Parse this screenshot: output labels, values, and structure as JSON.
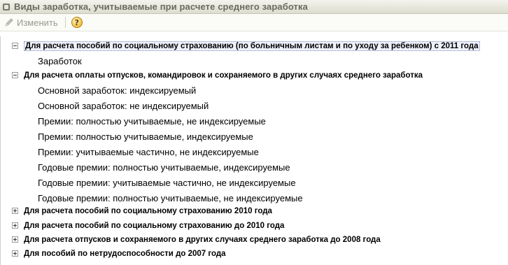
{
  "window": {
    "title": "Виды заработка, учитываемые при расчете среднего заработка"
  },
  "toolbar": {
    "edit_label": "Изменить",
    "help_label": "?"
  },
  "tree": [
    {
      "type": "group",
      "label": "Для расчета пособий по социальному страхованию (по больничным листам и по уходу за ребенком) с 2011 года",
      "expanded": true,
      "selected": true
    },
    {
      "type": "item",
      "label": "Заработок"
    },
    {
      "type": "group",
      "label": "Для расчета оплаты отпусков, командировок и сохраняемого в других случаях среднего заработка",
      "expanded": true,
      "selected": false
    },
    {
      "type": "item",
      "label": "Основной заработок: индексируемый"
    },
    {
      "type": "item",
      "label": "Основной заработок: не индексируемый"
    },
    {
      "type": "item",
      "label": "Премии: полностью учитываемые, не индексируемые"
    },
    {
      "type": "item",
      "label": "Премии: полностью учитываемые, индексируемые"
    },
    {
      "type": "item",
      "label": "Премии: учитываемые частично, не индексируемые"
    },
    {
      "type": "item",
      "label": "Годовые премии: полностью учитываемые, индексируемые"
    },
    {
      "type": "item",
      "label": "Годовые премии: учитываемые частично, не индексируемые"
    },
    {
      "type": "item",
      "label": "Годовые премии: полностью учитываемые, не индексируемые"
    },
    {
      "type": "group",
      "label": "Для расчета пособий по социальному страхованию 2010 года",
      "expanded": false,
      "selected": false
    },
    {
      "type": "group",
      "label": "Для расчета пособий по социальному страхованию до 2010 года",
      "expanded": false,
      "selected": false
    },
    {
      "type": "group",
      "label": "Для расчета отпусков и сохраняемого в других случаях среднего заработка до 2008 года",
      "expanded": false,
      "selected": false
    },
    {
      "type": "group",
      "label": "Для пособий по нетрудоспособности до 2007 года",
      "expanded": false,
      "selected": false
    }
  ]
}
